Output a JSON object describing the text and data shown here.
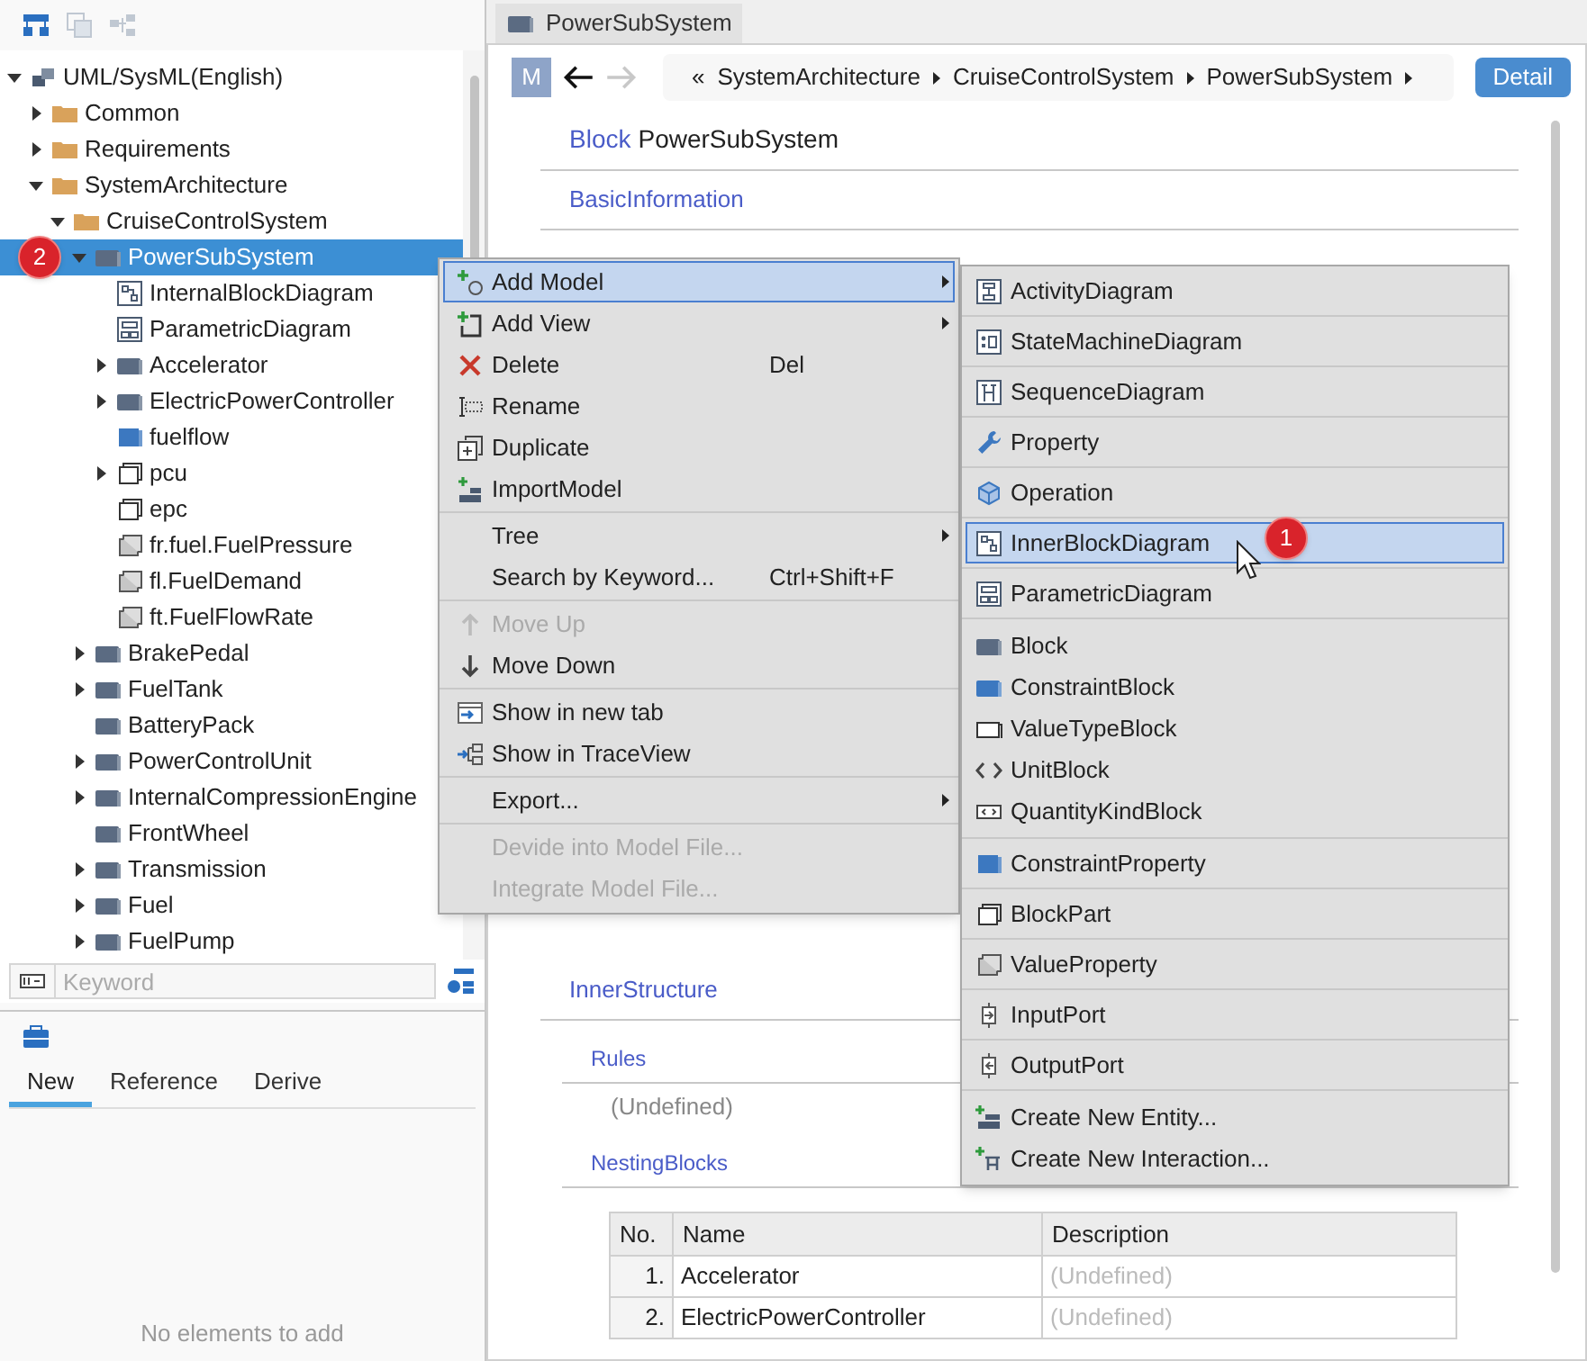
{
  "tree": {
    "items": [
      {
        "label": "UML/SysML(English)",
        "kind": "model",
        "expanded": true,
        "selected": false,
        "children": [
          {
            "label": "Common",
            "kind": "folder",
            "expanded": false,
            "selected": false
          },
          {
            "label": "Requirements",
            "kind": "folder",
            "expanded": false,
            "selected": false
          },
          {
            "label": "SystemArchitecture",
            "kind": "folder",
            "expanded": true,
            "selected": false,
            "children": [
              {
                "label": "CruiseControlSystem",
                "kind": "folder",
                "expanded": true,
                "selected": false,
                "children": [
                  {
                    "label": "PowerSubSystem",
                    "kind": "block",
                    "expanded": true,
                    "selected": true,
                    "marker": "2",
                    "children": [
                      {
                        "label": "InternalBlockDiagram",
                        "kind": "ibd",
                        "selected": false
                      },
                      {
                        "label": "ParametricDiagram",
                        "kind": "parametric",
                        "selected": false
                      },
                      {
                        "label": "Accelerator",
                        "kind": "block",
                        "expanded": false,
                        "selected": false
                      },
                      {
                        "label": "ElectricPowerController",
                        "kind": "block",
                        "expanded": false,
                        "selected": false
                      },
                      {
                        "label": "fuelflow",
                        "kind": "constraint-property",
                        "selected": false
                      },
                      {
                        "label": "pcu",
                        "kind": "part",
                        "expanded": false,
                        "selected": false
                      },
                      {
                        "label": "epc",
                        "kind": "part",
                        "selected": false
                      },
                      {
                        "label": "fr.fuel.FuelPressure",
                        "kind": "value-property",
                        "selected": false
                      },
                      {
                        "label": "fl.FuelDemand",
                        "kind": "value-property",
                        "selected": false
                      },
                      {
                        "label": "ft.FuelFlowRate",
                        "kind": "value-property",
                        "selected": false
                      }
                    ]
                  },
                  {
                    "label": "BrakePedal",
                    "kind": "block",
                    "expanded": false,
                    "selected": false
                  },
                  {
                    "label": "FuelTank",
                    "kind": "block",
                    "expanded": false,
                    "selected": false
                  },
                  {
                    "label": "BatteryPack",
                    "kind": "block",
                    "selected": false
                  },
                  {
                    "label": "PowerControlUnit",
                    "kind": "block",
                    "expanded": false,
                    "selected": false
                  },
                  {
                    "label": "InternalCompressionEngine",
                    "kind": "block",
                    "expanded": false,
                    "selected": false
                  },
                  {
                    "label": "FrontWheel",
                    "kind": "block",
                    "selected": false
                  },
                  {
                    "label": "Transmission",
                    "kind": "block",
                    "expanded": false,
                    "selected": false
                  },
                  {
                    "label": "Fuel",
                    "kind": "block",
                    "expanded": false,
                    "selected": false
                  },
                  {
                    "label": "FuelPump",
                    "kind": "block",
                    "expanded": false,
                    "selected": false
                  }
                ]
              }
            ]
          }
        ]
      }
    ]
  },
  "search": {
    "placeholder": "Keyword"
  },
  "toolbox": {
    "tabs": [
      {
        "label": "New",
        "selected": true
      },
      {
        "label": "Reference",
        "selected": false
      },
      {
        "label": "Derive",
        "selected": false
      }
    ],
    "empty_message": "No elements to add"
  },
  "editor_tabs": [
    {
      "label": "PowerSubSystem",
      "selected": true
    }
  ],
  "nav": {
    "avatar": "M",
    "history": [
      {
        "kind": "back",
        "disabled": false
      },
      {
        "kind": "forward",
        "disabled": true
      }
    ],
    "breadcrumb_lead": "«",
    "breadcrumb": [
      "SystemArchitecture",
      "CruiseControlSystem",
      "PowerSubSystem"
    ],
    "detail_button": "Detail"
  },
  "document": {
    "type_label": "Block",
    "title": "PowerSubSystem",
    "basic_section": "BasicInformation",
    "inner_section": "InnerStructure",
    "rules": {
      "heading": "Rules",
      "value": "(Undefined)"
    },
    "nesting": {
      "heading": "NestingBlocks",
      "columns": [
        "No.",
        "Name",
        "Description"
      ],
      "rows": [
        [
          "1.",
          "Accelerator",
          "(Undefined)"
        ],
        [
          "2.",
          "ElectricPowerController",
          "(Undefined)"
        ]
      ]
    }
  },
  "context_menu": {
    "groups": [
      [
        {
          "label": "Add Model",
          "kind": "add-model",
          "submenu": true,
          "disabled": false,
          "highlighted": true
        },
        {
          "label": "Add View",
          "kind": "add-view",
          "submenu": true,
          "disabled": false,
          "highlighted": false
        },
        {
          "label": "Delete",
          "kind": "delete",
          "shortcut": "Del",
          "submenu": false,
          "disabled": false,
          "highlighted": false
        },
        {
          "label": "Rename",
          "kind": "rename",
          "submenu": false,
          "disabled": false,
          "highlighted": false
        },
        {
          "label": "Duplicate",
          "kind": "duplicate",
          "submenu": false,
          "disabled": false,
          "highlighted": false
        },
        {
          "label": "ImportModel",
          "kind": "import",
          "submenu": false,
          "disabled": false,
          "highlighted": false
        }
      ],
      [
        {
          "label": "Tree",
          "kind": "none",
          "submenu": true,
          "disabled": false,
          "highlighted": false
        },
        {
          "label": "Search by Keyword...",
          "kind": "none",
          "shortcut": "Ctrl+Shift+F",
          "submenu": false,
          "disabled": false,
          "highlighted": false
        }
      ],
      [
        {
          "label": "Move Up",
          "kind": "move-up",
          "submenu": false,
          "disabled": true,
          "highlighted": false
        },
        {
          "label": "Move Down",
          "kind": "move-down",
          "submenu": false,
          "disabled": false,
          "highlighted": false
        }
      ],
      [
        {
          "label": "Show in new tab",
          "kind": "new-tab",
          "submenu": false,
          "disabled": false,
          "highlighted": false
        },
        {
          "label": "Show in TraceView",
          "kind": "trace-view",
          "submenu": false,
          "disabled": false,
          "highlighted": false
        }
      ],
      [
        {
          "label": "Export...",
          "kind": "none",
          "submenu": true,
          "disabled": false,
          "highlighted": false
        }
      ],
      [
        {
          "label": "Devide into Model File...",
          "kind": "none",
          "submenu": false,
          "disabled": true,
          "highlighted": false
        },
        {
          "label": "Integrate Model File...",
          "kind": "none",
          "submenu": false,
          "disabled": true,
          "highlighted": false
        }
      ]
    ]
  },
  "submenu": {
    "groups": [
      [
        {
          "label": "ActivityDiagram",
          "kind": "activity-diagram",
          "highlighted": false
        }
      ],
      [
        {
          "label": "StateMachineDiagram",
          "kind": "state-machine-diagram",
          "highlighted": false
        }
      ],
      [
        {
          "label": "SequenceDiagram",
          "kind": "sequence-diagram",
          "highlighted": false
        }
      ],
      [
        {
          "label": "Property",
          "kind": "property",
          "highlighted": false
        }
      ],
      [
        {
          "label": "Operation",
          "kind": "operation",
          "highlighted": false
        }
      ],
      [
        {
          "label": "InnerBlockDiagram",
          "kind": "ibd",
          "highlighted": true,
          "marker": "1"
        }
      ],
      [
        {
          "label": "ParametricDiagram",
          "kind": "parametric",
          "highlighted": false
        }
      ],
      [
        {
          "label": "Block",
          "kind": "block",
          "highlighted": false
        },
        {
          "label": "ConstraintBlock",
          "kind": "constraint-block",
          "highlighted": false
        },
        {
          "label": "ValueTypeBlock",
          "kind": "value-type-block",
          "highlighted": false
        },
        {
          "label": "UnitBlock",
          "kind": "unit-block",
          "highlighted": false
        },
        {
          "label": "QuantityKindBlock",
          "kind": "quantity-kind-block",
          "highlighted": false
        }
      ],
      [
        {
          "label": "ConstraintProperty",
          "kind": "constraint-property",
          "highlighted": false
        }
      ],
      [
        {
          "label": "BlockPart",
          "kind": "part",
          "highlighted": false
        }
      ],
      [
        {
          "label": "ValueProperty",
          "kind": "value-property",
          "highlighted": false
        }
      ],
      [
        {
          "label": "InputPort",
          "kind": "input-port",
          "highlighted": false
        }
      ],
      [
        {
          "label": "OutputPort",
          "kind": "output-port",
          "highlighted": false
        }
      ],
      [
        {
          "label": "Create New Entity...",
          "kind": "create-entity",
          "highlighted": false
        },
        {
          "label": "Create New Interaction...",
          "kind": "create-interaction",
          "highlighted": false
        }
      ]
    ]
  }
}
